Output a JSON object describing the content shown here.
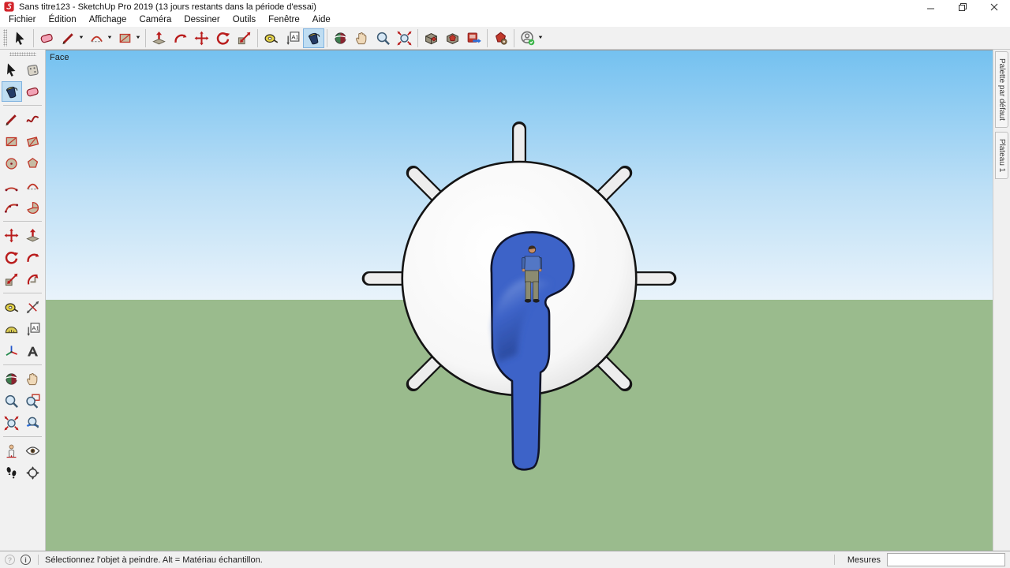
{
  "window": {
    "title": "Sans titre123 - SketchUp Pro 2019 (13 jours restants dans la période d'essai)"
  },
  "menu": {
    "items": [
      "Fichier",
      "Édition",
      "Affichage",
      "Caméra",
      "Dessiner",
      "Outils",
      "Fenêtre",
      "Aide"
    ]
  },
  "toolbar_top": {
    "groups": [
      {
        "items": [
          {
            "name": "select-tool",
            "icon": "cursor"
          }
        ]
      },
      {
        "items": [
          {
            "name": "eraser-tool",
            "icon": "eraser"
          },
          {
            "name": "line-tool",
            "icon": "pencil",
            "dropdown": true
          },
          {
            "name": "arc-tool",
            "icon": "arc2",
            "dropdown": true
          },
          {
            "name": "rectangle-tool",
            "icon": "rect",
            "dropdown": true
          }
        ]
      },
      {
        "items": [
          {
            "name": "push-pull-tool",
            "icon": "pushpull"
          },
          {
            "name": "follow-me-tool",
            "icon": "followme"
          },
          {
            "name": "move-tool",
            "icon": "move"
          },
          {
            "name": "rotate-tool",
            "icon": "rotate"
          },
          {
            "name": "scale-tool",
            "icon": "scale"
          }
        ]
      },
      {
        "items": [
          {
            "name": "tape-measure-tool",
            "icon": "tape"
          },
          {
            "name": "text-tool",
            "icon": "text"
          },
          {
            "name": "paint-bucket-tool",
            "icon": "bucket",
            "selected": true
          }
        ]
      },
      {
        "items": [
          {
            "name": "orbit-tool",
            "icon": "orbit"
          },
          {
            "name": "pan-tool",
            "icon": "pan"
          },
          {
            "name": "zoom-tool",
            "icon": "zoom"
          },
          {
            "name": "zoom-extents-tool",
            "icon": "zoomext"
          }
        ]
      },
      {
        "items": [
          {
            "name": "3d-warehouse",
            "icon": "warehouse"
          },
          {
            "name": "share-model",
            "icon": "share"
          },
          {
            "name": "extension-warehouse",
            "icon": "extwh"
          }
        ]
      },
      {
        "items": [
          {
            "name": "extension-manager",
            "icon": "extmgr"
          }
        ]
      },
      {
        "items": [
          {
            "name": "account",
            "icon": "account",
            "dropdown": true
          }
        ]
      }
    ]
  },
  "toolbar_left": {
    "sections": [
      [
        {
          "name": "select-tool",
          "icon": "cursor"
        },
        {
          "name": "make-component-tool",
          "icon": "component"
        },
        {
          "name": "paint-bucket-tool",
          "icon": "bucket",
          "selected": true
        },
        {
          "name": "eraser-tool",
          "icon": "eraser"
        }
      ],
      [
        {
          "name": "line-tool",
          "icon": "pencil"
        },
        {
          "name": "freehand-tool",
          "icon": "freehand"
        },
        {
          "name": "rectangle-tool",
          "icon": "rect"
        },
        {
          "name": "rotated-rectangle-tool",
          "icon": "rotrect"
        },
        {
          "name": "circle-tool",
          "icon": "circle"
        },
        {
          "name": "polygon-tool",
          "icon": "polygon"
        },
        {
          "name": "arc-tool",
          "icon": "arc"
        },
        {
          "name": "two-point-arc-tool",
          "icon": "arc2"
        },
        {
          "name": "three-point-arc-tool",
          "icon": "arc3"
        },
        {
          "name": "pie-tool",
          "icon": "pie"
        }
      ],
      [
        {
          "name": "move-tool",
          "icon": "move"
        },
        {
          "name": "push-pull-tool",
          "icon": "pushpull"
        },
        {
          "name": "rotate-tool",
          "icon": "rotate"
        },
        {
          "name": "follow-me-tool",
          "icon": "followme"
        },
        {
          "name": "scale-tool",
          "icon": "scale"
        },
        {
          "name": "offset-tool",
          "icon": "offset"
        }
      ],
      [
        {
          "name": "tape-measure-tool",
          "icon": "tape"
        },
        {
          "name": "dimension-tool",
          "icon": "dimension"
        },
        {
          "name": "protractor-tool",
          "icon": "protractor"
        },
        {
          "name": "text-tool",
          "icon": "text"
        },
        {
          "name": "axes-tool",
          "icon": "axes"
        },
        {
          "name": "3d-text-tool",
          "icon": "text3d"
        }
      ],
      [
        {
          "name": "orbit-tool",
          "icon": "orbit"
        },
        {
          "name": "pan-tool",
          "icon": "pan"
        },
        {
          "name": "zoom-tool",
          "icon": "zoom"
        },
        {
          "name": "zoom-window-tool",
          "icon": "zoomwin"
        },
        {
          "name": "zoom-extents-tool",
          "icon": "zoomext"
        },
        {
          "name": "previous-view-tool",
          "icon": "prev"
        }
      ],
      [
        {
          "name": "position-camera-tool",
          "icon": "poscam"
        },
        {
          "name": "look-around-tool",
          "icon": "lookaround"
        },
        {
          "name": "walk-tool",
          "icon": "walk"
        },
        {
          "name": "navigation-tool",
          "icon": "navcircle"
        }
      ]
    ]
  },
  "viewport": {
    "scene_label": "Face"
  },
  "right_panel": {
    "tabs": [
      {
        "label": "Palette par défaut"
      },
      {
        "label": "Plateau 1"
      }
    ]
  },
  "statusbar": {
    "help_glyph": "?",
    "info_glyph": "i",
    "hint": "Sélectionnez l'objet à peindre. Alt = Matériau échantillon.",
    "measures_label": "Mesures",
    "measures_value": ""
  },
  "colors": {
    "selection_highlight": "#BFDDF2",
    "sky_top": "#74C1F0",
    "sky_horizon": "#E9F3FB",
    "ground_green": "#9ABB8D",
    "model_white": "#FBFBFB",
    "model_blue": "#3D63C8",
    "outline_black": "#141414"
  }
}
